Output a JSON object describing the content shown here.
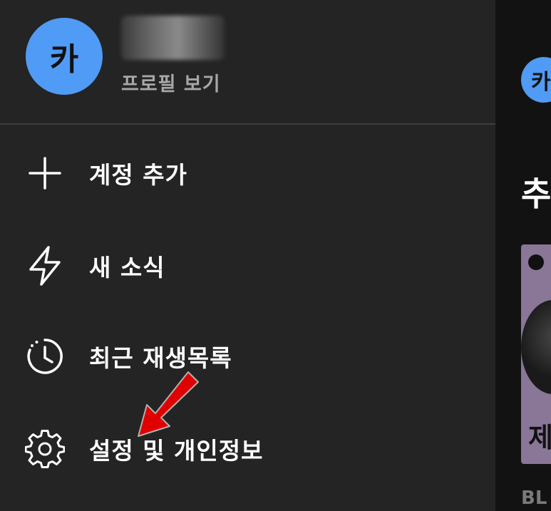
{
  "profile": {
    "avatar_letter": "카",
    "avatar_color": "#509bf5",
    "name_redacted": true,
    "view_profile_label": "프로필 보기"
  },
  "menu": {
    "items": [
      {
        "icon": "plus-icon",
        "label": "계정 추가"
      },
      {
        "icon": "lightning-icon",
        "label": "새 소식"
      },
      {
        "icon": "history-icon",
        "label": "최근 재생목록"
      },
      {
        "icon": "gear-icon",
        "label": "설정 및 개인정보"
      }
    ]
  },
  "background_page": {
    "avatar_letter": "카",
    "heading_fragment": "추",
    "card_text_fragment": "제",
    "caption_fragment": "BL"
  },
  "annotation": {
    "arrow_color": "#e00000"
  }
}
